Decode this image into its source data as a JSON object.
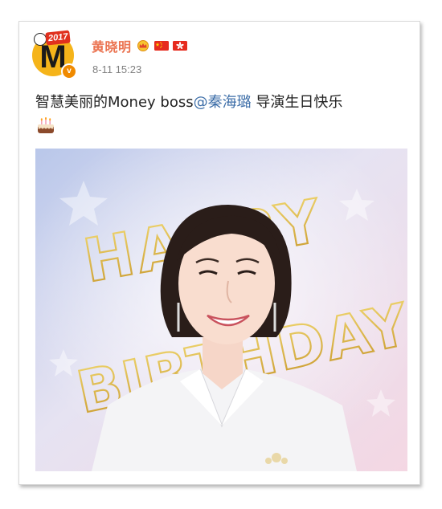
{
  "post": {
    "username": "黄晓明",
    "timestamp": "8-11 15:23",
    "text_prefix": "智慧美丽的Money boss",
    "mention": "@秦海璐",
    "text_suffix": " 导演生日快乐"
  },
  "avatar": {
    "letter": "M",
    "badge_year": "2017",
    "verify_mark": "v"
  },
  "photo": {
    "headline_line1": "HAPPY",
    "headline_line2": "BIRTHDAY"
  },
  "colors": {
    "username": "#eb7350",
    "mention": "#3d6ea8",
    "text": "#222222",
    "timestamp": "#808080",
    "gold": "#d9b646"
  },
  "icons": [
    "crown-badge-icon",
    "china-flag-icon",
    "hong-kong-flag-icon",
    "birthday-cake-icon",
    "verified-icon"
  ]
}
